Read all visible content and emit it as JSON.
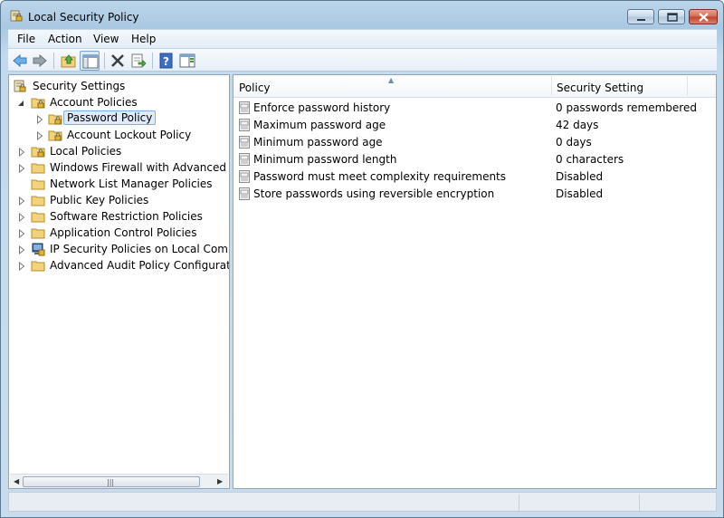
{
  "window": {
    "title": "Local Security Policy",
    "icon": "security-policy-icon"
  },
  "menu": [
    "File",
    "Action",
    "View",
    "Help"
  ],
  "toolbar": {
    "buttons": [
      "back-arrow-icon",
      "forward-arrow-icon",
      "up-folder-icon",
      "show-hide-tree-icon",
      "delete-icon",
      "export-list-icon",
      "help-icon",
      "show-action-pane-icon"
    ]
  },
  "tree": {
    "root": "Security Settings",
    "items": [
      {
        "label": "Account Policies",
        "expanded": true
      },
      {
        "label": "Password Policy",
        "selected": true
      },
      {
        "label": "Account Lockout Policy"
      },
      {
        "label": "Local Policies"
      },
      {
        "label": "Windows Firewall with Advanced Secu"
      },
      {
        "label": "Network List Manager Policies"
      },
      {
        "label": "Public Key Policies"
      },
      {
        "label": "Software Restriction Policies"
      },
      {
        "label": "Application Control Policies"
      },
      {
        "label": "IP Security Policies on Local Compute"
      },
      {
        "label": "Advanced Audit Policy Configuration"
      }
    ]
  },
  "list": {
    "columns": [
      "Policy",
      "Security Setting"
    ],
    "rows": [
      {
        "policy": "Enforce password history",
        "setting": "0 passwords remembered"
      },
      {
        "policy": "Maximum password age",
        "setting": "42 days"
      },
      {
        "policy": "Minimum password age",
        "setting": "0 days"
      },
      {
        "policy": "Minimum password length",
        "setting": "0 characters"
      },
      {
        "policy": "Password must meet complexity requirements",
        "setting": "Disabled"
      },
      {
        "policy": "Store passwords using reversible encryption",
        "setting": "Disabled"
      }
    ]
  },
  "colors": {
    "selection_bg": "#dfeafb",
    "selection_border": "#84acdd",
    "title_bar": "#bcd6ea",
    "close_button": "#c1412a"
  }
}
